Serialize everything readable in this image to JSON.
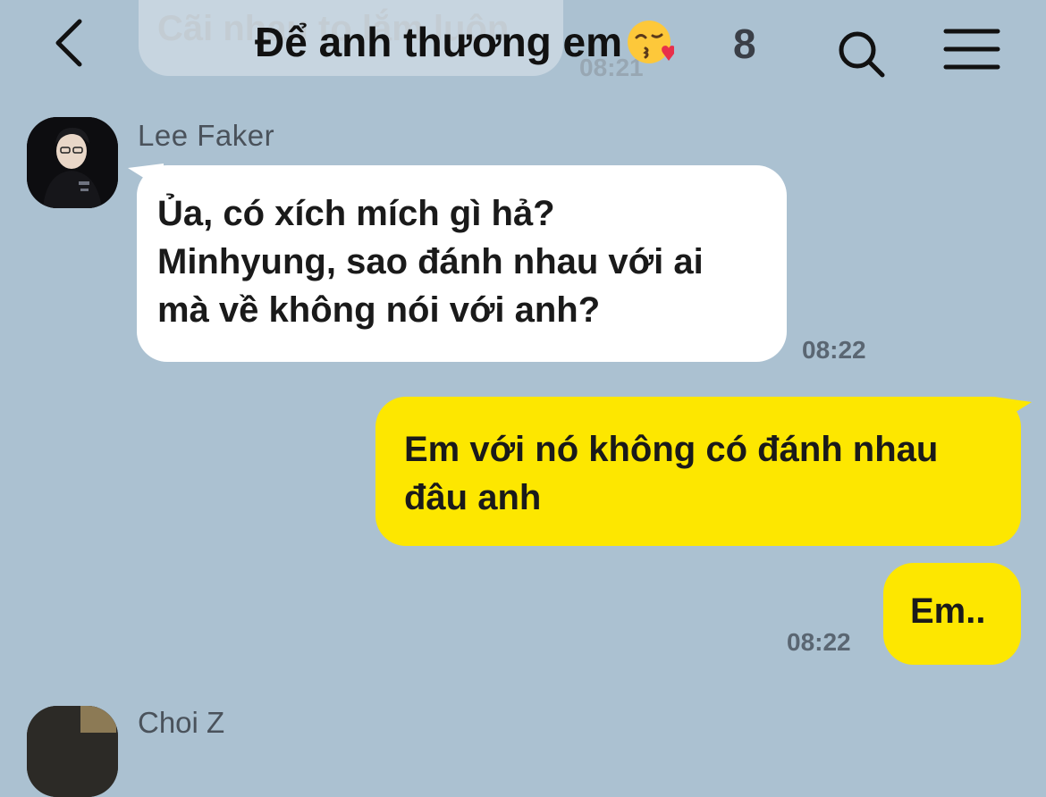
{
  "previous_message": {
    "text": "Cãi nhau to lắm luôn",
    "time": "08:21"
  },
  "header": {
    "title": "Để anh thương em",
    "title_emoji": "kissing-face-with-heart-emoji",
    "member_count": "8",
    "back_icon": "chevron-left-icon",
    "search_icon": "search-icon",
    "menu_icon": "hamburger-menu-icon"
  },
  "messages": [
    {
      "direction": "incoming",
      "sender": "Lee Faker",
      "lines": [
        "Ủa, có xích mích gì hả?",
        "Minhyung, sao đánh nhau với ai",
        "mà về không nói với anh?"
      ],
      "time": "08:22"
    },
    {
      "direction": "outgoing",
      "lines": [
        "Em với nó không có đánh nhau",
        "đâu anh"
      ]
    },
    {
      "direction": "outgoing",
      "lines": [
        "Em.."
      ],
      "time": "08:22"
    }
  ],
  "next_sender": {
    "name": "Choi Z"
  },
  "colors": {
    "background": "#abc1d1",
    "incoming_bubble": "#ffffff",
    "outgoing_bubble": "#fde700"
  }
}
